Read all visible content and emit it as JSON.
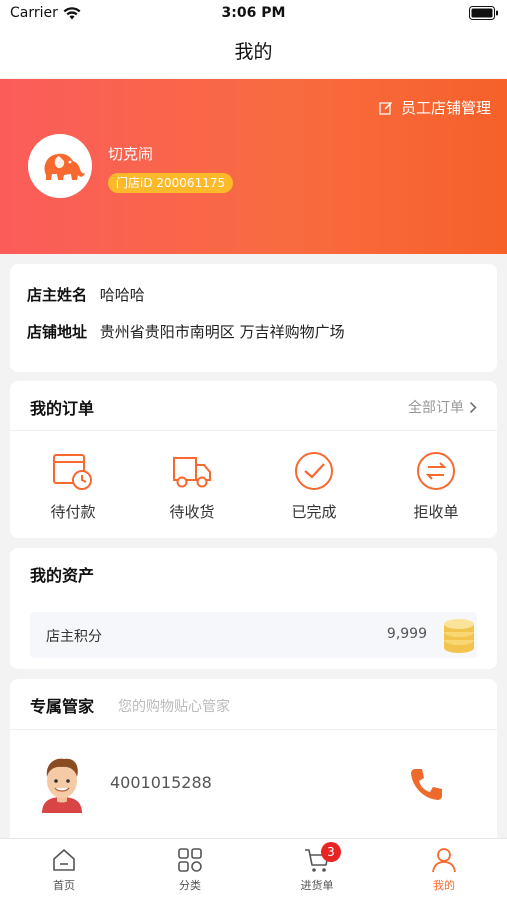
{
  "status_bar": {
    "carrier": "Carrier",
    "time": "3:06 PM"
  },
  "nav": {
    "title": "我的"
  },
  "header": {
    "staff_link": "员工店铺管理",
    "shop_name": "切克闹",
    "shop_id": "门店iD 200061175",
    "gradient_colors": [
      "#fb5c5b",
      "#f6612a"
    ]
  },
  "shop_info": {
    "owner_label": "店主姓名",
    "owner_value": "哈哈哈",
    "address_label": "店铺地址",
    "address_value": "贵州省贵阳市南明区 万吉祥购物广场"
  },
  "orders": {
    "title": "我的订单",
    "all_link": "全部订单",
    "items": [
      {
        "label": "待付款",
        "icon": "pending-payment-icon"
      },
      {
        "label": "待收货",
        "icon": "delivery-truck-icon"
      },
      {
        "label": "已完成",
        "icon": "check-circle-icon"
      },
      {
        "label": "拒收单",
        "icon": "exchange-circle-icon"
      }
    ]
  },
  "assets": {
    "title": "我的资产",
    "points_label": "店主积分",
    "points_value": "9,999"
  },
  "manager": {
    "title": "专属管家",
    "subtitle": "您的购物贴心管家",
    "phone": "4001015288"
  },
  "tabs": [
    {
      "label": "首页",
      "icon": "home-icon"
    },
    {
      "label": "分类",
      "icon": "grid-icon"
    },
    {
      "label": "进货单",
      "icon": "cart-icon",
      "badge": "3"
    },
    {
      "label": "我的",
      "icon": "user-icon",
      "active": true
    }
  ],
  "colors": {
    "accent": "#f7692f",
    "badge": "#e82323",
    "id_tag": "#fcb92a"
  }
}
